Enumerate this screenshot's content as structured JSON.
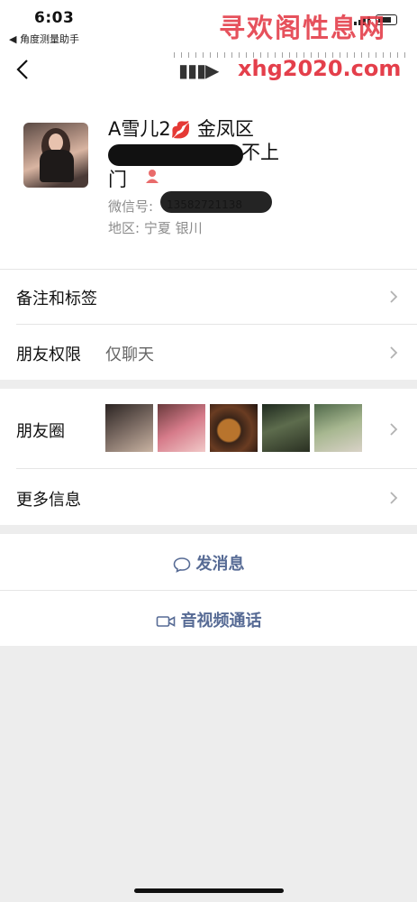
{
  "status_bar": {
    "time": "6:03",
    "back_app": "◀ 角度测量助手"
  },
  "watermark": {
    "title": "寻欢阁性息网",
    "url": "xhg2020.com",
    "color": "#e43f4b"
  },
  "profile": {
    "name": "A雪儿2",
    "name_emoji": "💋",
    "district": "金凤区",
    "phone_suffix": "不上",
    "door": "门",
    "wechat_label": "微信号:",
    "wechat_value": "13582721138",
    "region": "地区: 宁夏 银川"
  },
  "rows": {
    "notes_label": "备注和标签",
    "permission_label": "朋友权限",
    "permission_value": "仅聊天",
    "moments_label": "朋友圈",
    "more_label": "更多信息"
  },
  "actions": {
    "send_message": "发消息",
    "av_call": "音视频通话",
    "accent": "#576b95"
  },
  "icons": [
    "back-arrow-icon",
    "user-icon",
    "chevron-right-icon",
    "chat-bubble-icon",
    "video-camera-icon"
  ]
}
